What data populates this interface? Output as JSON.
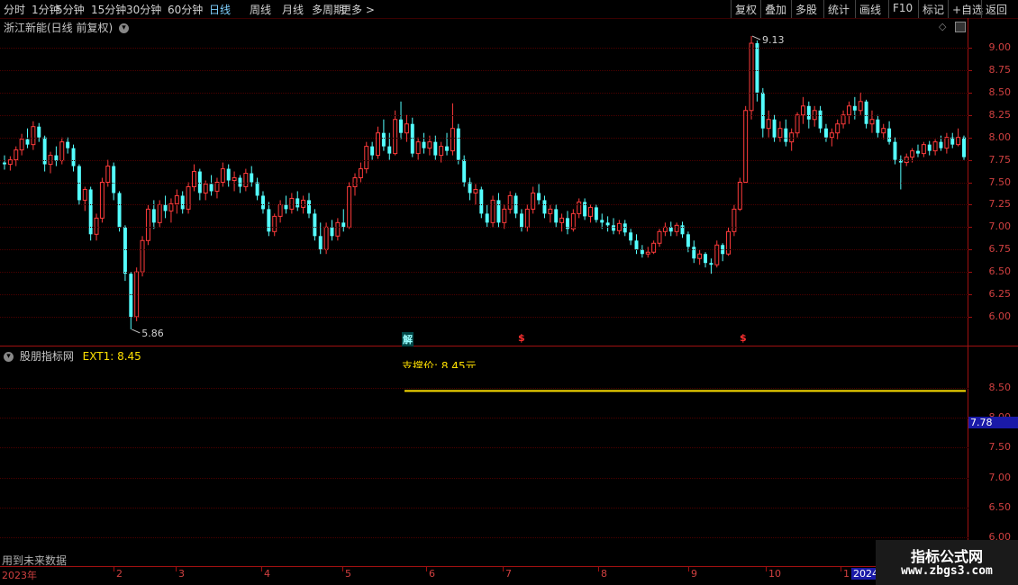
{
  "toolbar": {
    "left_items": [
      "分时",
      "1分钟",
      "5分钟",
      "15分钟",
      "30分钟",
      "60分钟",
      "日线",
      "周线",
      "月线",
      "多周期",
      "更多 >"
    ],
    "active": "日线",
    "right_items": [
      "复权",
      "叠加",
      "多股",
      "统计",
      "画线",
      "F10",
      "标记",
      "+自选",
      "返回"
    ]
  },
  "main_panel": {
    "title": "浙江新能(日线 前复权)",
    "high_label": "9.13",
    "low_label": "5.86",
    "price_axis": [
      "9.00",
      "8.75",
      "8.50",
      "8.25",
      "8.00",
      "7.75",
      "7.50",
      "7.25",
      "7.00",
      "6.75",
      "6.50",
      "6.25",
      "6.00"
    ],
    "markers": [
      {
        "text": "解",
        "color": "#00c8c8"
      },
      {
        "text": "$",
        "color": "#ff3030"
      },
      {
        "text": "$",
        "color": "#ff3030"
      }
    ]
  },
  "sub_panel": {
    "title": "股朋指标网",
    "ext_label": "EXT1: 8.45",
    "annotation": "支撑价: 8.45元",
    "price_tag": "7.78",
    "axis": [
      "8.50",
      "8.00",
      "7.50",
      "7.00",
      "6.50",
      "6.00"
    ]
  },
  "footer": {
    "note": "用到未来数据",
    "year_start": "2023年",
    "months": [
      "2",
      "3",
      "4",
      "5",
      "6",
      "7",
      "8",
      "9",
      "10",
      "1"
    ],
    "year_end": "2024"
  },
  "watermark": {
    "title": "指标公式网",
    "url": "www.zbgs3.com"
  },
  "colors": {
    "up": "#ff3b3b",
    "down": "#54ffff",
    "axis": "#d04040",
    "support_line": "#ffe000",
    "text": "#c8c8c8"
  },
  "chart_data": {
    "type": "candlestick",
    "y_range": [
      5.8,
      9.2
    ],
    "ohlc": [
      [
        7.72,
        7.8,
        7.64,
        7.7
      ],
      [
        7.7,
        7.79,
        7.63,
        7.75
      ],
      [
        7.75,
        7.9,
        7.68,
        7.86
      ],
      [
        7.86,
        8.04,
        7.8,
        7.98
      ],
      [
        7.98,
        8.1,
        7.88,
        7.92
      ],
      [
        7.92,
        8.18,
        7.86,
        8.12
      ],
      [
        8.12,
        8.16,
        7.95,
        8.0
      ],
      [
        8.0,
        8.02,
        7.62,
        7.7
      ],
      [
        7.7,
        7.84,
        7.6,
        7.8
      ],
      [
        7.8,
        7.9,
        7.68,
        7.74
      ],
      [
        7.74,
        8.0,
        7.7,
        7.95
      ],
      [
        7.95,
        8.0,
        7.82,
        7.88
      ],
      [
        7.88,
        7.92,
        7.62,
        7.68
      ],
      [
        7.68,
        7.7,
        7.25,
        7.3
      ],
      [
        7.3,
        7.45,
        7.18,
        7.42
      ],
      [
        7.42,
        7.45,
        6.85,
        6.92
      ],
      [
        6.92,
        7.15,
        6.85,
        7.1
      ],
      [
        7.1,
        7.55,
        7.05,
        7.5
      ],
      [
        7.5,
        7.75,
        7.45,
        7.68
      ],
      [
        7.68,
        7.72,
        7.3,
        7.38
      ],
      [
        7.38,
        7.4,
        6.95,
        7.0
      ],
      [
        7.0,
        7.02,
        6.4,
        6.48
      ],
      [
        6.48,
        6.5,
        5.86,
        6.0
      ],
      [
        6.0,
        6.55,
        5.95,
        6.5
      ],
      [
        6.5,
        6.9,
        6.45,
        6.85
      ],
      [
        6.85,
        7.25,
        6.8,
        7.2
      ],
      [
        7.2,
        7.3,
        6.98,
        7.05
      ],
      [
        7.05,
        7.3,
        7.0,
        7.25
      ],
      [
        7.25,
        7.35,
        7.1,
        7.18
      ],
      [
        7.18,
        7.32,
        7.05,
        7.26
      ],
      [
        7.26,
        7.42,
        7.15,
        7.35
      ],
      [
        7.35,
        7.4,
        7.15,
        7.2
      ],
      [
        7.2,
        7.5,
        7.15,
        7.45
      ],
      [
        7.45,
        7.7,
        7.4,
        7.62
      ],
      [
        7.62,
        7.65,
        7.3,
        7.38
      ],
      [
        7.38,
        7.52,
        7.3,
        7.48
      ],
      [
        7.48,
        7.58,
        7.35,
        7.4
      ],
      [
        7.4,
        7.55,
        7.32,
        7.5
      ],
      [
        7.5,
        7.72,
        7.45,
        7.65
      ],
      [
        7.65,
        7.7,
        7.45,
        7.52
      ],
      [
        7.52,
        7.62,
        7.4,
        7.55
      ],
      [
        7.55,
        7.58,
        7.38,
        7.45
      ],
      [
        7.45,
        7.65,
        7.4,
        7.6
      ],
      [
        7.6,
        7.68,
        7.45,
        7.5
      ],
      [
        7.5,
        7.55,
        7.3,
        7.35
      ],
      [
        7.35,
        7.4,
        7.15,
        7.2
      ],
      [
        7.2,
        7.28,
        6.9,
        6.95
      ],
      [
        6.95,
        7.15,
        6.9,
        7.12
      ],
      [
        7.12,
        7.3,
        7.05,
        7.25
      ],
      [
        7.25,
        7.35,
        7.15,
        7.2
      ],
      [
        7.2,
        7.38,
        7.15,
        7.32
      ],
      [
        7.32,
        7.4,
        7.18,
        7.22
      ],
      [
        7.22,
        7.35,
        7.15,
        7.3
      ],
      [
        7.3,
        7.38,
        7.1,
        7.15
      ],
      [
        7.15,
        7.2,
        6.85,
        6.9
      ],
      [
        6.9,
        7.05,
        6.7,
        6.75
      ],
      [
        6.75,
        7.05,
        6.7,
        7.0
      ],
      [
        7.0,
        7.08,
        6.85,
        6.9
      ],
      [
        6.9,
        7.1,
        6.85,
        7.05
      ],
      [
        7.05,
        7.2,
        6.95,
        7.0
      ],
      [
        7.0,
        7.5,
        6.98,
        7.45
      ],
      [
        7.45,
        7.6,
        7.35,
        7.55
      ],
      [
        7.55,
        7.72,
        7.5,
        7.65
      ],
      [
        7.65,
        7.95,
        7.6,
        7.9
      ],
      [
        7.9,
        7.95,
        7.75,
        7.8
      ],
      [
        7.8,
        8.12,
        7.76,
        8.05
      ],
      [
        8.05,
        8.2,
        7.85,
        7.9
      ],
      [
        7.9,
        8.05,
        7.75,
        7.82
      ],
      [
        7.82,
        8.3,
        7.8,
        8.2
      ],
      [
        8.2,
        8.4,
        7.98,
        8.05
      ],
      [
        8.05,
        8.25,
        7.95,
        8.15
      ],
      [
        8.15,
        8.22,
        7.78,
        7.82
      ],
      [
        7.82,
        8.0,
        7.75,
        7.95
      ],
      [
        7.95,
        8.05,
        7.82,
        7.88
      ],
      [
        7.88,
        8.02,
        7.8,
        7.95
      ],
      [
        7.95,
        8.02,
        7.75,
        7.8
      ],
      [
        7.8,
        7.95,
        7.72,
        7.9
      ],
      [
        7.9,
        8.05,
        7.8,
        7.85
      ],
      [
        7.85,
        8.38,
        7.8,
        8.1
      ],
      [
        8.1,
        8.15,
        7.7,
        7.75
      ],
      [
        7.75,
        7.8,
        7.45,
        7.5
      ],
      [
        7.5,
        7.55,
        7.3,
        7.38
      ],
      [
        7.38,
        7.48,
        7.25,
        7.42
      ],
      [
        7.42,
        7.45,
        7.1,
        7.15
      ],
      [
        7.15,
        7.25,
        7.0,
        7.05
      ],
      [
        7.05,
        7.35,
        7.0,
        7.3
      ],
      [
        7.3,
        7.38,
        7.0,
        7.05
      ],
      [
        7.05,
        7.25,
        6.98,
        7.2
      ],
      [
        7.2,
        7.4,
        7.15,
        7.35
      ],
      [
        7.35,
        7.38,
        7.1,
        7.15
      ],
      [
        7.15,
        7.2,
        6.95,
        7.0
      ],
      [
        7.0,
        7.25,
        6.95,
        7.2
      ],
      [
        7.2,
        7.45,
        7.15,
        7.38
      ],
      [
        7.38,
        7.48,
        7.25,
        7.3
      ],
      [
        7.3,
        7.35,
        7.1,
        7.15
      ],
      [
        7.15,
        7.25,
        7.05,
        7.2
      ],
      [
        7.2,
        7.25,
        7.0,
        7.05
      ],
      [
        7.05,
        7.15,
        6.95,
        7.1
      ],
      [
        7.1,
        7.18,
        6.92,
        6.98
      ],
      [
        6.98,
        7.2,
        6.95,
        7.15
      ],
      [
        7.15,
        7.32,
        7.1,
        7.28
      ],
      [
        7.28,
        7.32,
        7.08,
        7.12
      ],
      [
        7.12,
        7.25,
        7.05,
        7.22
      ],
      [
        7.22,
        7.25,
        7.05,
        7.08
      ],
      [
        7.08,
        7.15,
        6.98,
        7.05
      ],
      [
        7.05,
        7.12,
        6.95,
        7.02
      ],
      [
        7.02,
        7.1,
        6.92,
        6.96
      ],
      [
        6.96,
        7.08,
        6.92,
        7.04
      ],
      [
        7.04,
        7.08,
        6.9,
        6.94
      ],
      [
        6.94,
        6.98,
        6.8,
        6.85
      ],
      [
        6.85,
        6.92,
        6.7,
        6.75
      ],
      [
        6.75,
        6.8,
        6.66,
        6.7
      ],
      [
        6.7,
        6.78,
        6.66,
        6.72
      ],
      [
        6.72,
        6.85,
        6.7,
        6.82
      ],
      [
        6.82,
        6.98,
        6.78,
        6.95
      ],
      [
        6.95,
        7.05,
        6.9,
        7.0
      ],
      [
        7.0,
        7.06,
        6.9,
        6.95
      ],
      [
        6.95,
        7.05,
        6.9,
        7.02
      ],
      [
        7.02,
        7.06,
        6.88,
        6.92
      ],
      [
        6.92,
        6.95,
        6.72,
        6.78
      ],
      [
        6.78,
        6.85,
        6.6,
        6.65
      ],
      [
        6.65,
        6.75,
        6.58,
        6.7
      ],
      [
        6.7,
        6.72,
        6.55,
        6.6
      ],
      [
        6.6,
        6.65,
        6.48,
        6.58
      ],
      [
        6.58,
        6.85,
        6.55,
        6.8
      ],
      [
        6.8,
        6.82,
        6.62,
        6.7
      ],
      [
        6.7,
        7.0,
        6.68,
        6.95
      ],
      [
        6.95,
        7.25,
        6.9,
        7.2
      ],
      [
        7.2,
        7.55,
        7.18,
        7.5
      ],
      [
        7.5,
        8.35,
        7.8,
        8.3
      ],
      [
        8.3,
        9.13,
        8.2,
        9.05
      ],
      [
        9.05,
        9.08,
        8.4,
        8.5
      ],
      [
        8.5,
        8.55,
        8.0,
        8.1
      ],
      [
        8.1,
        8.3,
        8.0,
        8.2
      ],
      [
        8.2,
        8.25,
        7.95,
        8.0
      ],
      [
        8.0,
        8.18,
        7.95,
        8.1
      ],
      [
        8.1,
        8.2,
        7.9,
        7.95
      ],
      [
        7.95,
        8.1,
        7.85,
        8.05
      ],
      [
        8.05,
        8.28,
        8.0,
        8.25
      ],
      [
        8.25,
        8.45,
        8.15,
        8.35
      ],
      [
        8.35,
        8.4,
        8.1,
        8.2
      ],
      [
        8.2,
        8.35,
        8.12,
        8.3
      ],
      [
        8.3,
        8.35,
        8.05,
        8.1
      ],
      [
        8.1,
        8.15,
        7.95,
        8.0
      ],
      [
        8.0,
        8.1,
        7.9,
        8.05
      ],
      [
        8.05,
        8.2,
        7.98,
        8.15
      ],
      [
        8.15,
        8.3,
        8.1,
        8.25
      ],
      [
        8.25,
        8.4,
        8.15,
        8.35
      ],
      [
        8.35,
        8.45,
        8.2,
        8.3
      ],
      [
        8.3,
        8.5,
        8.25,
        8.4
      ],
      [
        8.4,
        8.42,
        8.1,
        8.15
      ],
      [
        8.15,
        8.3,
        8.05,
        8.2
      ],
      [
        8.2,
        8.25,
        8.0,
        8.05
      ],
      [
        8.05,
        8.15,
        7.98,
        8.1
      ],
      [
        8.1,
        8.18,
        7.92,
        7.95
      ],
      [
        7.95,
        8.0,
        7.7,
        7.75
      ],
      [
        7.75,
        7.8,
        7.42,
        7.72
      ],
      [
        7.72,
        7.82,
        7.68,
        7.78
      ],
      [
        7.78,
        7.88,
        7.72,
        7.85
      ],
      [
        7.85,
        7.92,
        7.78,
        7.82
      ],
      [
        7.82,
        7.95,
        7.78,
        7.92
      ],
      [
        7.92,
        7.96,
        7.8,
        7.85
      ],
      [
        7.85,
        7.98,
        7.8,
        7.95
      ],
      [
        7.95,
        8.02,
        7.85,
        7.88
      ],
      [
        7.88,
        8.05,
        7.82,
        8.0
      ],
      [
        8.0,
        8.05,
        7.88,
        7.92
      ],
      [
        7.92,
        8.1,
        7.9,
        8.0
      ],
      [
        8.0,
        8.02,
        7.75,
        7.78
      ]
    ],
    "support_price": 8.45,
    "sub_y_range": [
      5.95,
      8.95
    ]
  }
}
